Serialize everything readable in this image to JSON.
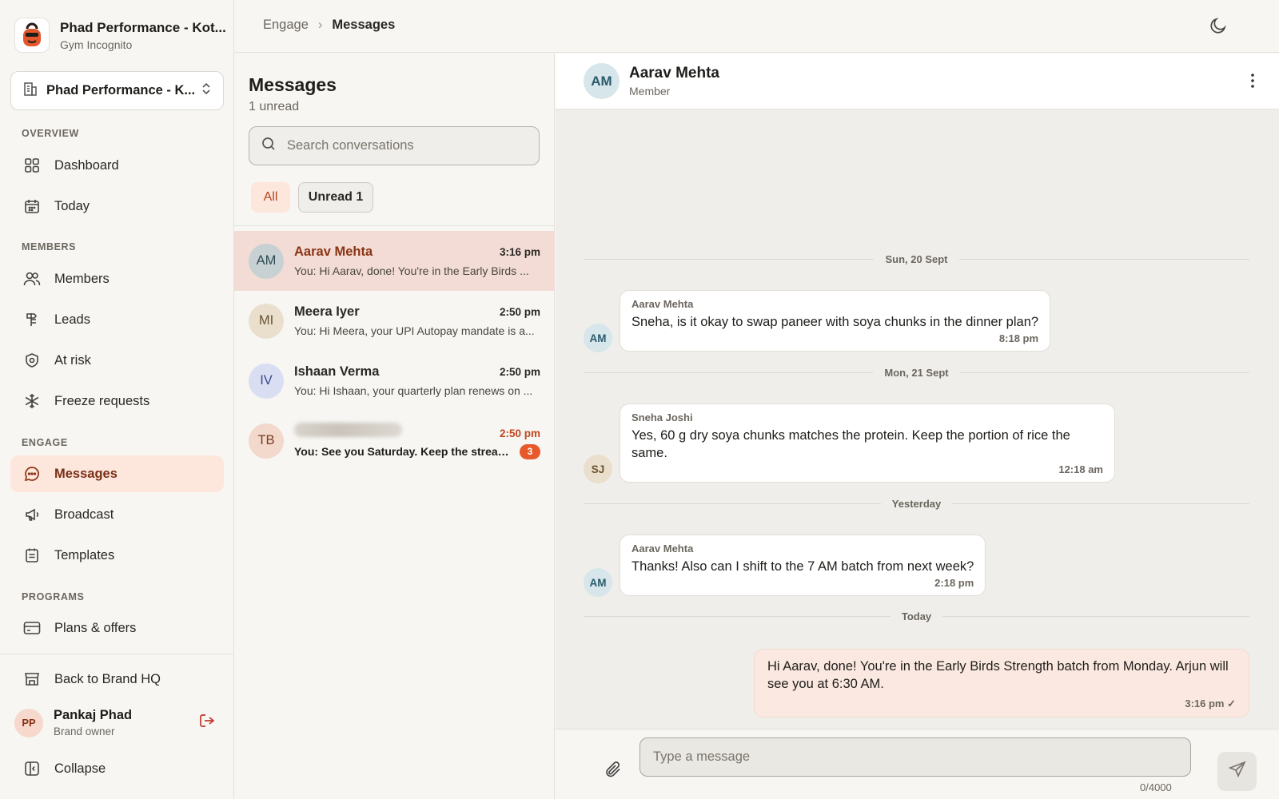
{
  "brand": {
    "name": "Phad Performance - Kot...",
    "subtitle": "Gym Incognito"
  },
  "location_select": {
    "label": "Phad Performance - K..."
  },
  "nav": {
    "sections": {
      "overview": "OVERVIEW",
      "members": "MEMBERS",
      "engage": "ENGAGE",
      "programs": "PROGRAMS"
    },
    "items": [
      {
        "label": "Dashboard",
        "icon": "grid-icon"
      },
      {
        "label": "Today",
        "icon": "calendar-icon"
      },
      {
        "label": "Members",
        "icon": "users-icon"
      },
      {
        "label": "Leads",
        "icon": "signpost-icon"
      },
      {
        "label": "At risk",
        "icon": "shield-icon"
      },
      {
        "label": "Freeze requests",
        "icon": "snowflake-icon"
      },
      {
        "label": "Messages",
        "icon": "message-icon",
        "active": true
      },
      {
        "label": "Broadcast",
        "icon": "megaphone-icon"
      },
      {
        "label": "Templates",
        "icon": "calendar-list-icon"
      },
      {
        "label": "Plans & offers",
        "icon": "card-icon"
      }
    ],
    "back": "Back to Brand HQ",
    "collapse": "Collapse"
  },
  "user": {
    "initials": "PP",
    "name": "Pankaj Phad",
    "role": "Brand owner"
  },
  "breadcrumb": {
    "parent": "Engage",
    "current": "Messages"
  },
  "conversations_panel": {
    "title": "Messages",
    "subtitle": "1 unread",
    "search_placeholder": "Search conversations",
    "filters": {
      "all": "All",
      "unread": "Unread 1"
    },
    "items": [
      {
        "initials": "AM",
        "name": "Aarav Mehta",
        "time": "3:16 pm",
        "preview": "You: Hi Aarav, done! You're in the Early Birds ...",
        "active": true
      },
      {
        "initials": "MI",
        "name": "Meera Iyer",
        "time": "2:50 pm",
        "preview": "You: Hi Meera, your UPI Autopay mandate is a..."
      },
      {
        "initials": "IV",
        "name": "Ishaan Verma",
        "time": "2:50 pm",
        "preview": "You: Hi Ishaan, your quarterly plan renews on ..."
      },
      {
        "initials": "TB",
        "name": "",
        "time": "2:50 pm",
        "preview": "You: See you Saturday. Keep the streak...",
        "unread_count": "3"
      }
    ]
  },
  "chat": {
    "contact": {
      "initials": "AM",
      "name": "Aarav Mehta",
      "role": "Member"
    },
    "dates": [
      "Sun, 20 Sept",
      "Mon, 21 Sept",
      "Yesterday",
      "Today"
    ],
    "messages": [
      {
        "initials": "AM",
        "sender": "Aarav Mehta",
        "text": "Sneha, is it okay to swap paneer with soya chunks in the dinner plan?",
        "time": "8:18 pm"
      },
      {
        "initials": "SJ",
        "sender": "Sneha Joshi",
        "text": "Yes, 60 g dry soya chunks matches the protein. Keep the portion of rice the same.",
        "time": "12:18 am"
      },
      {
        "initials": "AM",
        "sender": "Aarav Mehta",
        "text": "Thanks! Also can I shift to the 7 AM batch from next week?",
        "time": "2:18 pm"
      },
      {
        "text": "Hi Aarav, done! You're in the Early Birds Strength batch from Monday. Arjun will see you at 6:30 AM.",
        "time": "3:16 pm ✓"
      }
    ],
    "composer": {
      "placeholder": "Type a message",
      "counter": "0/4000"
    }
  }
}
